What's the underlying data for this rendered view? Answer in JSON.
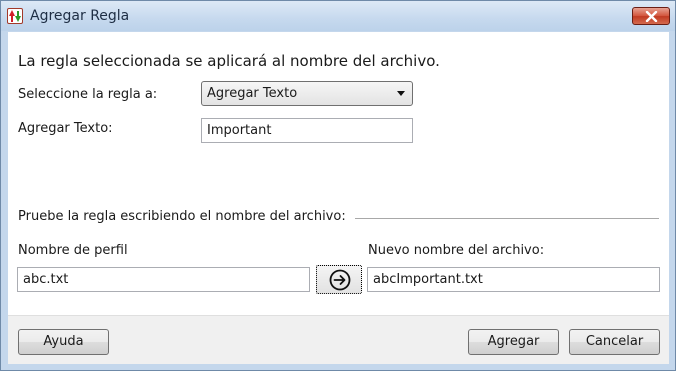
{
  "window": {
    "title": "Agregar Regla"
  },
  "dialog": {
    "description": "La regla seleccionada se aplicará al nombre del archivo.",
    "rule_label": "Seleccione la regla a:",
    "rule_selected": "Agregar Texto",
    "text_label": "Agregar Texto:",
    "text_value": "Important",
    "test_group_label": "Pruebe la regla escribiendo el nombre del archivo:",
    "profile_label": "Nombre de perfil",
    "profile_value": "abc.txt",
    "new_name_label": "Nuevo nombre del archivo:",
    "new_name_value": "abcImportant.txt"
  },
  "buttons": {
    "help": "Ayuda",
    "add": "Agregar",
    "cancel": "Cancelar"
  },
  "icons": {
    "app": "rename-app-icon",
    "close": "close-icon",
    "go": "arrow-right-circle-icon"
  },
  "colors": {
    "titlebar": "#c4d7ec",
    "close_button": "#c8442b",
    "footer": "#f0f0f0"
  }
}
